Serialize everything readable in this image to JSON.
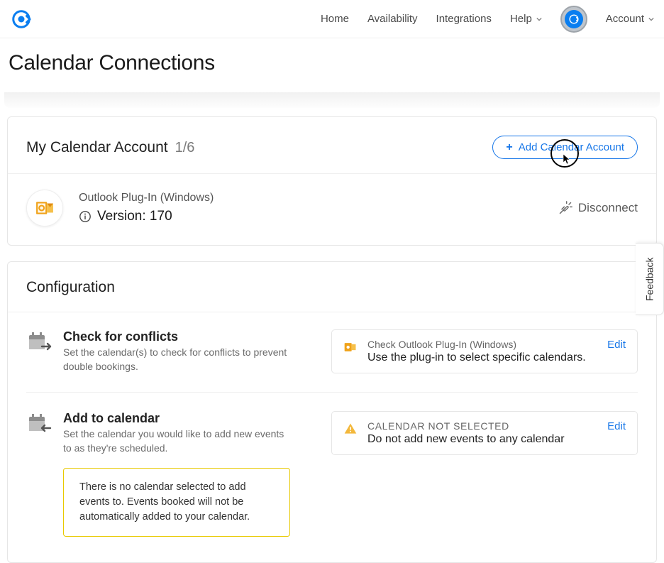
{
  "nav": {
    "home": "Home",
    "availability": "Availability",
    "integrations": "Integrations",
    "help": "Help",
    "account": "Account"
  },
  "page": {
    "title": "Calendar Connections"
  },
  "account_card": {
    "title": "My Calendar Account",
    "count": "1/6",
    "add_button": "Add Calendar Account",
    "connection": {
      "name": "Outlook Plug-In (Windows)",
      "version_label": "Version: 170",
      "disconnect": "Disconnect"
    }
  },
  "config": {
    "title": "Configuration",
    "conflicts": {
      "title": "Check for conflicts",
      "desc": "Set the calendar(s) to check for conflicts to prevent double bookings.",
      "panel_line1": "Check Outlook Plug-In (Windows)",
      "panel_line2": "Use the plug-in to select specific calendars.",
      "edit": "Edit"
    },
    "addto": {
      "title": "Add to calendar",
      "desc": "Set the calendar you would like to add new events to as they're scheduled.",
      "warn": "There is no calendar selected to add events to. Events booked will not be automatically added to your calendar.",
      "panel_line1": "CALENDAR NOT SELECTED",
      "panel_line2": "Do not add new events to any calendar",
      "edit": "Edit"
    }
  },
  "feedback": "Feedback"
}
